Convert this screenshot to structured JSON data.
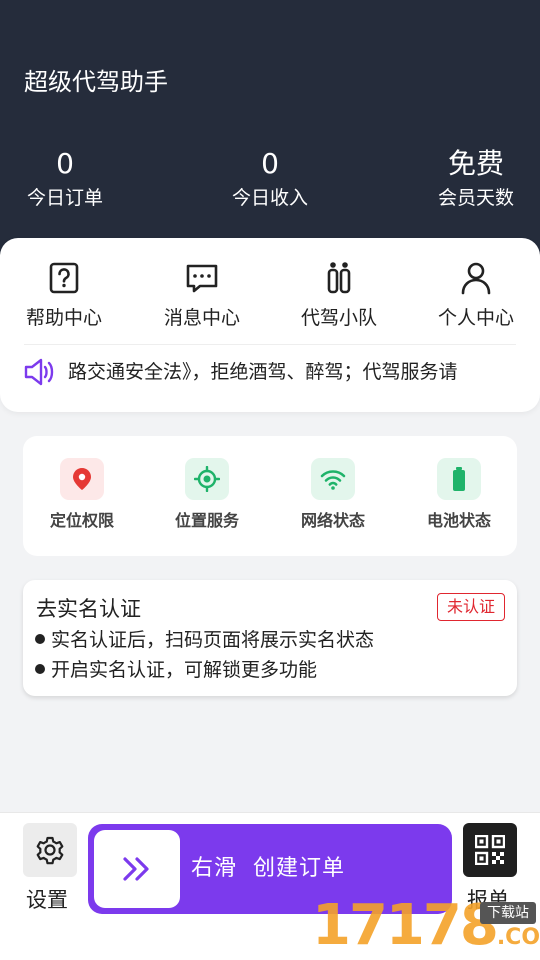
{
  "header": {
    "title": "超级代驾助手",
    "stats": [
      {
        "value": "0",
        "label": "今日订单"
      },
      {
        "value": "0",
        "label": "今日收入"
      },
      {
        "value": "免费",
        "label": "会员天数"
      }
    ],
    "background": "#252c3b"
  },
  "nav": [
    {
      "label": "帮助中心",
      "icon": "help-icon"
    },
    {
      "label": "消息中心",
      "icon": "message-icon"
    },
    {
      "label": "代驾小队",
      "icon": "team-icon"
    },
    {
      "label": "个人中心",
      "icon": "user-icon"
    }
  ],
  "notice": {
    "text": "路交通安全法》，拒绝酒驾、醉驾；代驾服务请",
    "icon": "speaker-icon",
    "icon_color": "#7c3aed"
  },
  "status": [
    {
      "label": "定位权限",
      "icon": "location-pin-icon",
      "color": "#e53935",
      "bg": "#fde8e8"
    },
    {
      "label": "位置服务",
      "icon": "target-icon",
      "color": "#1fb36a",
      "bg": "#e3f6ec"
    },
    {
      "label": "网络状态",
      "icon": "wifi-icon",
      "color": "#1fb36a",
      "bg": "#e3f6ec"
    },
    {
      "label": "电池状态",
      "icon": "battery-icon",
      "color": "#1fb36a",
      "bg": "#e3f6ec"
    }
  ],
  "auth": {
    "title": "去实名认证",
    "badge": "未认证",
    "badge_color": "#e0262f",
    "bullets": [
      "实名认证后，扫码页面将展示实名状态",
      "开启实名认证，可解锁更多功能"
    ]
  },
  "bottom": {
    "settings_label": "设置",
    "slider_text": "右滑 创建订单",
    "slider_color": "#7c3aed",
    "report_label": "报单"
  },
  "watermark": {
    "text": "17178",
    "suffix": ".COM",
    "tag": "下载站"
  }
}
